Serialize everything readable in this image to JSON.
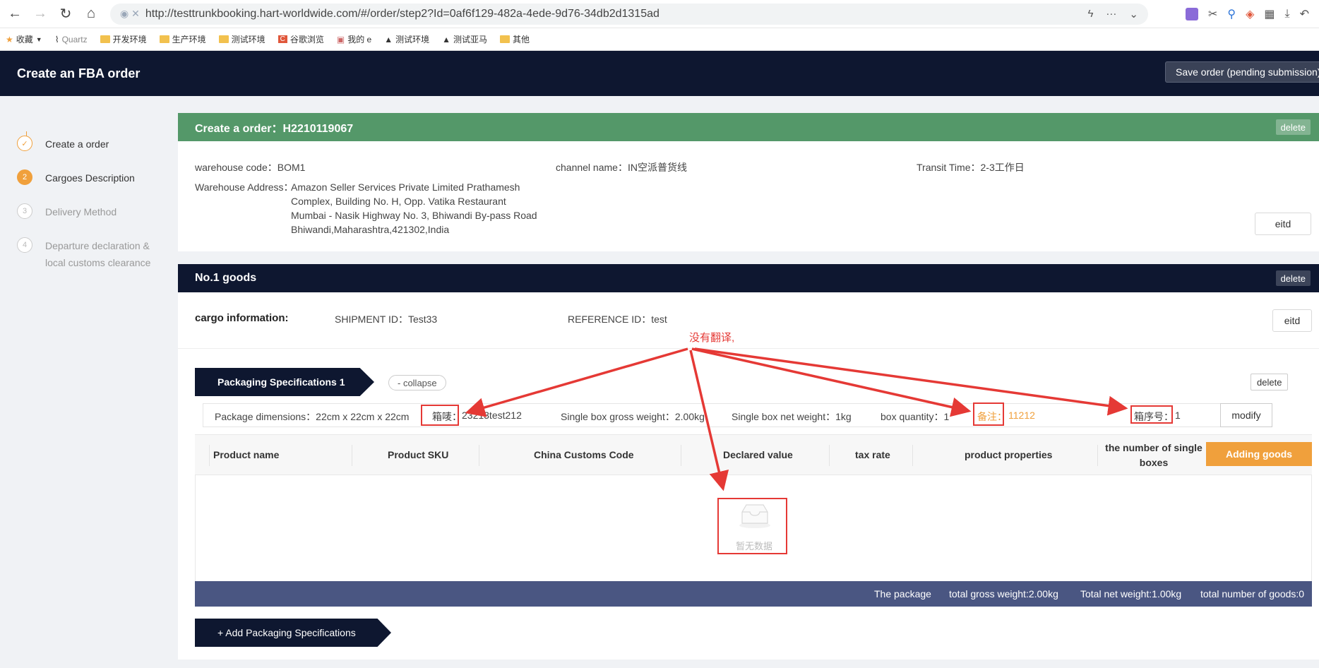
{
  "browser": {
    "url": "http://testtrunkbooking.hart-worldwide.com/#/order/step2?Id=0af6f129-482a-4ede-9d76-34db2d1315ad",
    "bookmarks": [
      "收藏",
      "Quartz",
      "开发环境",
      "生产环境",
      "测试环境",
      "谷歌浏览",
      "我的 e⁣",
      "测试环境",
      "测试亚马",
      "其他"
    ]
  },
  "header": {
    "title": "Create an FBA order",
    "save_label": "Save order (pending submission)"
  },
  "steps": [
    {
      "num": "✓",
      "label": "Create a order",
      "state": "done"
    },
    {
      "num": "2",
      "label": "Cargoes Description",
      "state": "active"
    },
    {
      "num": "3",
      "label": "Delivery Method",
      "state": "pending"
    },
    {
      "num": "4",
      "label": "Departure declaration & local customs clearance",
      "state": "pending"
    }
  ],
  "order": {
    "title": "Create a order：H2210119067",
    "delete_label": "delete",
    "warehouse_code": "warehouse code：BOM1",
    "channel_name": "channel name：IN空派普货线",
    "transit_time": "Transit Time：2-3工作日",
    "address_label": "Warehouse Address：",
    "address_lines": [
      "Amazon Seller Services Private Limited Prathamesh",
      "Complex, Building No. H, Opp. Vatika Restaurant",
      "Mumbai - Nasik Highway No. 3, Bhiwandi By-pass Road",
      "Bhiwandi,Maharashtra,421302,India"
    ],
    "edit_label": "eitd"
  },
  "goods": {
    "title": "No.1 goods",
    "delete_label": "delete",
    "cargo_label": "cargo information:",
    "shipment_id": "SHIPMENT ID：Test33",
    "reference_id": "REFERENCE ID：test",
    "edit_label": "eitd"
  },
  "packaging": {
    "tab_label": "Packaging Specifications 1",
    "collapse_label": "- collapse",
    "delete_label": "delete",
    "dimensions": "Package dimensions：22cm x 22cm x 22cm",
    "mark_label": "箱唛：",
    "mark_value": "23213test212",
    "gross_weight": "Single box gross weight：2.00kg",
    "net_weight": "Single box net weight：1kg",
    "box_quantity": "box quantity：1",
    "remark_label": "备注：",
    "remark_value": "11212",
    "box_no_label": "箱序号：",
    "box_no_value": "1",
    "modify_label": "modify"
  },
  "table": {
    "columns": [
      "Product name",
      "Product SKU",
      "China Customs Code",
      "Declared value",
      "tax rate",
      "product properties",
      "the number of single boxes"
    ],
    "add_goods_label": "Adding goods",
    "empty_text": "暂无数据"
  },
  "summary": {
    "package": "The package",
    "gross": "total gross weight:2.00kg",
    "net": "Total net weight:1.00kg",
    "goods": "total number of goods:0"
  },
  "add_spec_label": "+ Add Packaging Specifications",
  "annotation": {
    "text": "没有翻译,",
    "color": "#e53935"
  }
}
